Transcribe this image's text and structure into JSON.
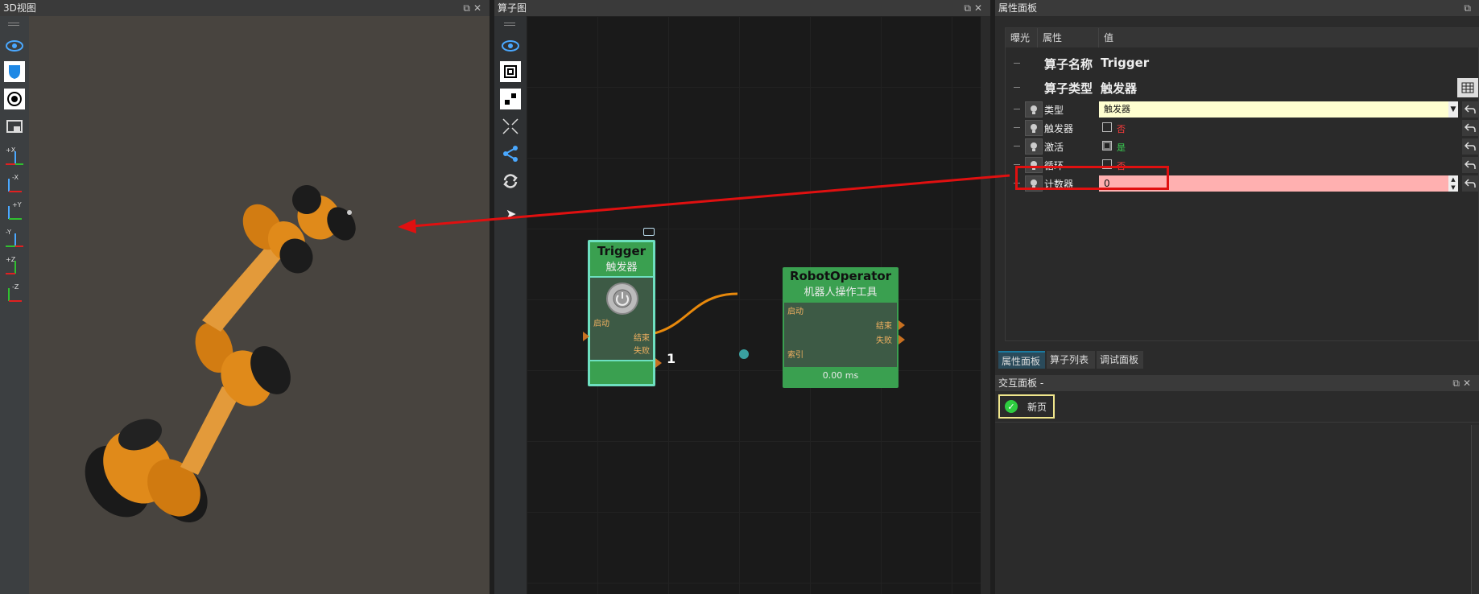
{
  "view3d": {
    "title": "3D视图",
    "toolbar": [
      {
        "name": "eye-icon"
      },
      {
        "name": "shield-icon"
      },
      {
        "name": "target-icon"
      },
      {
        "name": "screenshot-icon"
      },
      {
        "name": "axis-plus-x-icon",
        "label": "+X"
      },
      {
        "name": "axis-minus-x-icon",
        "label": "-X"
      },
      {
        "name": "axis-plus-y-icon",
        "label": "+Y"
      },
      {
        "name": "axis-minus-y-icon",
        "label": "-Y"
      },
      {
        "name": "axis-plus-z-icon",
        "label": "+Z"
      },
      {
        "name": "axis-minus-z-icon",
        "label": "-Z"
      }
    ]
  },
  "graph": {
    "title": "算子图",
    "toolbar": [
      "eye-icon",
      "fit-view-icon",
      "layout-icon",
      "expand-icon",
      "share-icon",
      "refresh-icon"
    ],
    "trigger_node": {
      "title": "Trigger",
      "subtitle": "触发器",
      "in_port": "启动",
      "out_ports": [
        "结束",
        "失败"
      ]
    },
    "robot_node": {
      "title": "RobotOperator",
      "subtitle": "机器人操作工具",
      "in_port": "启动",
      "index_port": "索引",
      "out_ports": [
        "结束",
        "失败"
      ],
      "time": "0.00 ms"
    },
    "connection_label": "1"
  },
  "props": {
    "title": "属性面板",
    "columns": [
      "曝光",
      "属性",
      "值"
    ],
    "operator_name_label": "算子名称",
    "operator_name": "Trigger",
    "operator_type_label": "算子类型",
    "operator_type": "触发器",
    "rows": [
      {
        "label": "类型",
        "value": "触发器"
      },
      {
        "label": "触发器",
        "value": "否",
        "checked": false,
        "color": "#ff3b3b"
      },
      {
        "label": "激活",
        "value": "是",
        "checked": true,
        "color": "#39d353"
      },
      {
        "label": "循环",
        "value": "否",
        "checked": false,
        "color": "#ff3b3b"
      },
      {
        "label": "计数器",
        "value": "0"
      }
    ],
    "tabs": [
      "属性面板",
      "算子列表",
      "调试面板"
    ]
  },
  "interact": {
    "title": "交互面板 -",
    "page_button": "新页"
  },
  "colors": {
    "accent_red": "#e01010",
    "node_green": "#3aa050",
    "node_border": "#6ee0c0",
    "wire_orange": "#e8890c",
    "robot_orange": "#e08a1a"
  }
}
